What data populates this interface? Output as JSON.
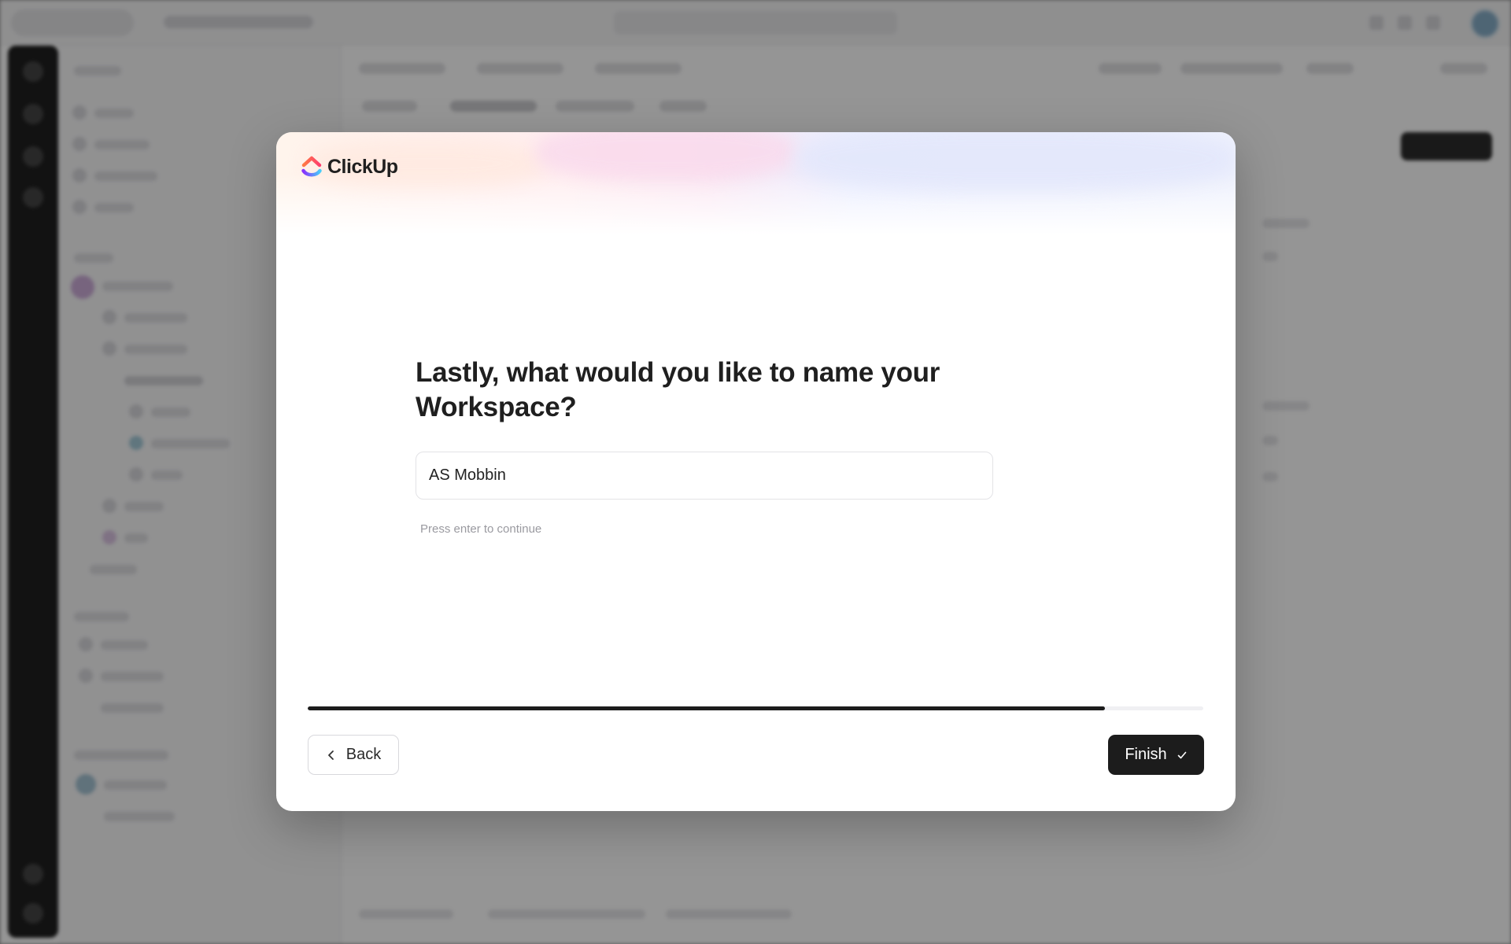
{
  "brand": {
    "name": "ClickUp",
    "logo_icon": "clickup-logo-icon",
    "colors": [
      "#fd71af",
      "#7b68ee",
      "#ff7a45",
      "#49ccf9"
    ]
  },
  "dialog": {
    "title": "Lastly, what would you like to name your Workspace?",
    "workspace_name_value": "AS Mobbin",
    "hint": "Press enter to continue",
    "progress_fraction": 0.89,
    "back_label": "Back",
    "back_icon": "chevron-left-icon",
    "finish_label": "Finish",
    "finish_icon": "check-icon"
  },
  "theme": {
    "primary_button": "#1c1c1c",
    "overlay": "rgba(20,20,20,0.45)"
  }
}
